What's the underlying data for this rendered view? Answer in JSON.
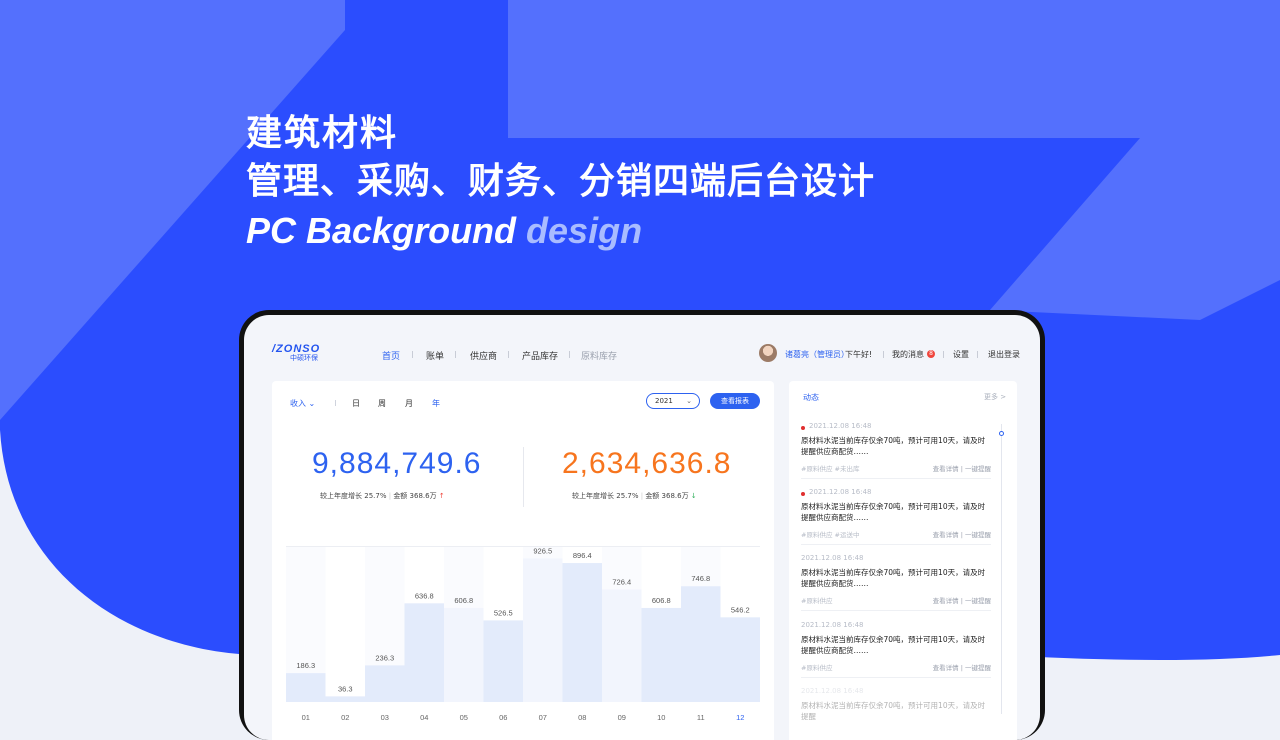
{
  "colors": {
    "brand_blue": "#2b4dfe",
    "brand_blue_light": "#5470fd",
    "primary": "#2d62f0",
    "orange": "#f7751e",
    "bar_highlight": "#e3ebfb",
    "bar_plain": "#f2f5fd"
  },
  "hero": {
    "line1": "建筑材料",
    "line2": "管理、采购、财务、分销四端后台设计",
    "en_main": "PC Background ",
    "en_dim": "design"
  },
  "app": {
    "logo_en": "/ZONSO",
    "logo_cn": "中硕环保",
    "nav": [
      "首页",
      "账单",
      "供应商",
      "产品库存",
      "原料库存"
    ],
    "user_name": "诸葛亮（管理员）",
    "greeting": "下午好!",
    "messages_label": "我的消息",
    "messages_count": "8",
    "settings_label": "设置",
    "logout_label": "退出登录"
  },
  "filters": {
    "income_label": "收入",
    "tabs": [
      "日",
      "周",
      "月",
      "年"
    ],
    "active_tab": "年",
    "year": "2021",
    "report_button": "查看报表"
  },
  "kpis": [
    {
      "value": "9,884,749.6",
      "yoy_label": "较上年度增长",
      "yoy": "25.7%",
      "amount_label": "金额",
      "amount": "368.6万",
      "trend": "up",
      "trend_icon": "↑"
    },
    {
      "value": "2,634,636.8",
      "yoy_label": "较上年度增长",
      "yoy": "25.7%",
      "amount_label": "金额",
      "amount": "368.6万",
      "trend": "down",
      "trend_icon": "↓"
    }
  ],
  "chart_data": {
    "type": "bar",
    "categories": [
      "01",
      "02",
      "03",
      "04",
      "05",
      "06",
      "07",
      "08",
      "09",
      "10",
      "11",
      "12"
    ],
    "values": [
      186.3,
      36.3,
      236.3,
      636.8,
      606.8,
      526.5,
      926.5,
      896.4,
      726.4,
      606.8,
      746.8,
      546.2
    ],
    "highlighted": [
      true,
      true,
      true,
      true,
      false,
      true,
      false,
      true,
      false,
      true,
      true,
      true
    ],
    "selected_category": "12",
    "ylim": [
      0,
      1000
    ],
    "title": "",
    "xlabel": "",
    "ylabel": ""
  },
  "feed": {
    "title": "动态",
    "more": "更多 >",
    "items": [
      {
        "time": "2021.12.08   16:48",
        "text": "原材料水泥当前库存仅余70吨，预计可用10天，请及时提醒供应商配货……",
        "tags": "#原料供应    #未出库",
        "view": "查看详情",
        "remind": "一键提醒",
        "unread": true
      },
      {
        "time": "2021.12.08   16:48",
        "text": "原材料水泥当前库存仅余70吨，预计可用10天，请及时提醒供应商配货……",
        "tags": "#原料供应    #运送中",
        "view": "查看详情",
        "remind": "一键提醒",
        "unread": true
      },
      {
        "time": "2021.12.08   16:48",
        "text": "原材料水泥当前库存仅余70吨，预计可用10天，请及时提醒供应商配货……",
        "tags": "#原料供应",
        "view": "查看详情",
        "remind": "一键提醒",
        "unread": false
      },
      {
        "time": "2021.12.08   16:48",
        "text": "原材料水泥当前库存仅余70吨，预计可用10天，请及时提醒供应商配货……",
        "tags": "#原料供应",
        "view": "查看详情",
        "remind": "一键提醒",
        "unread": false
      },
      {
        "time": "2021.12.08   16:48",
        "text": "原材料水泥当前库存仅余70吨，预计可用10天，请及时提醒",
        "tags": "",
        "view": "",
        "remind": "",
        "unread": false
      }
    ]
  }
}
